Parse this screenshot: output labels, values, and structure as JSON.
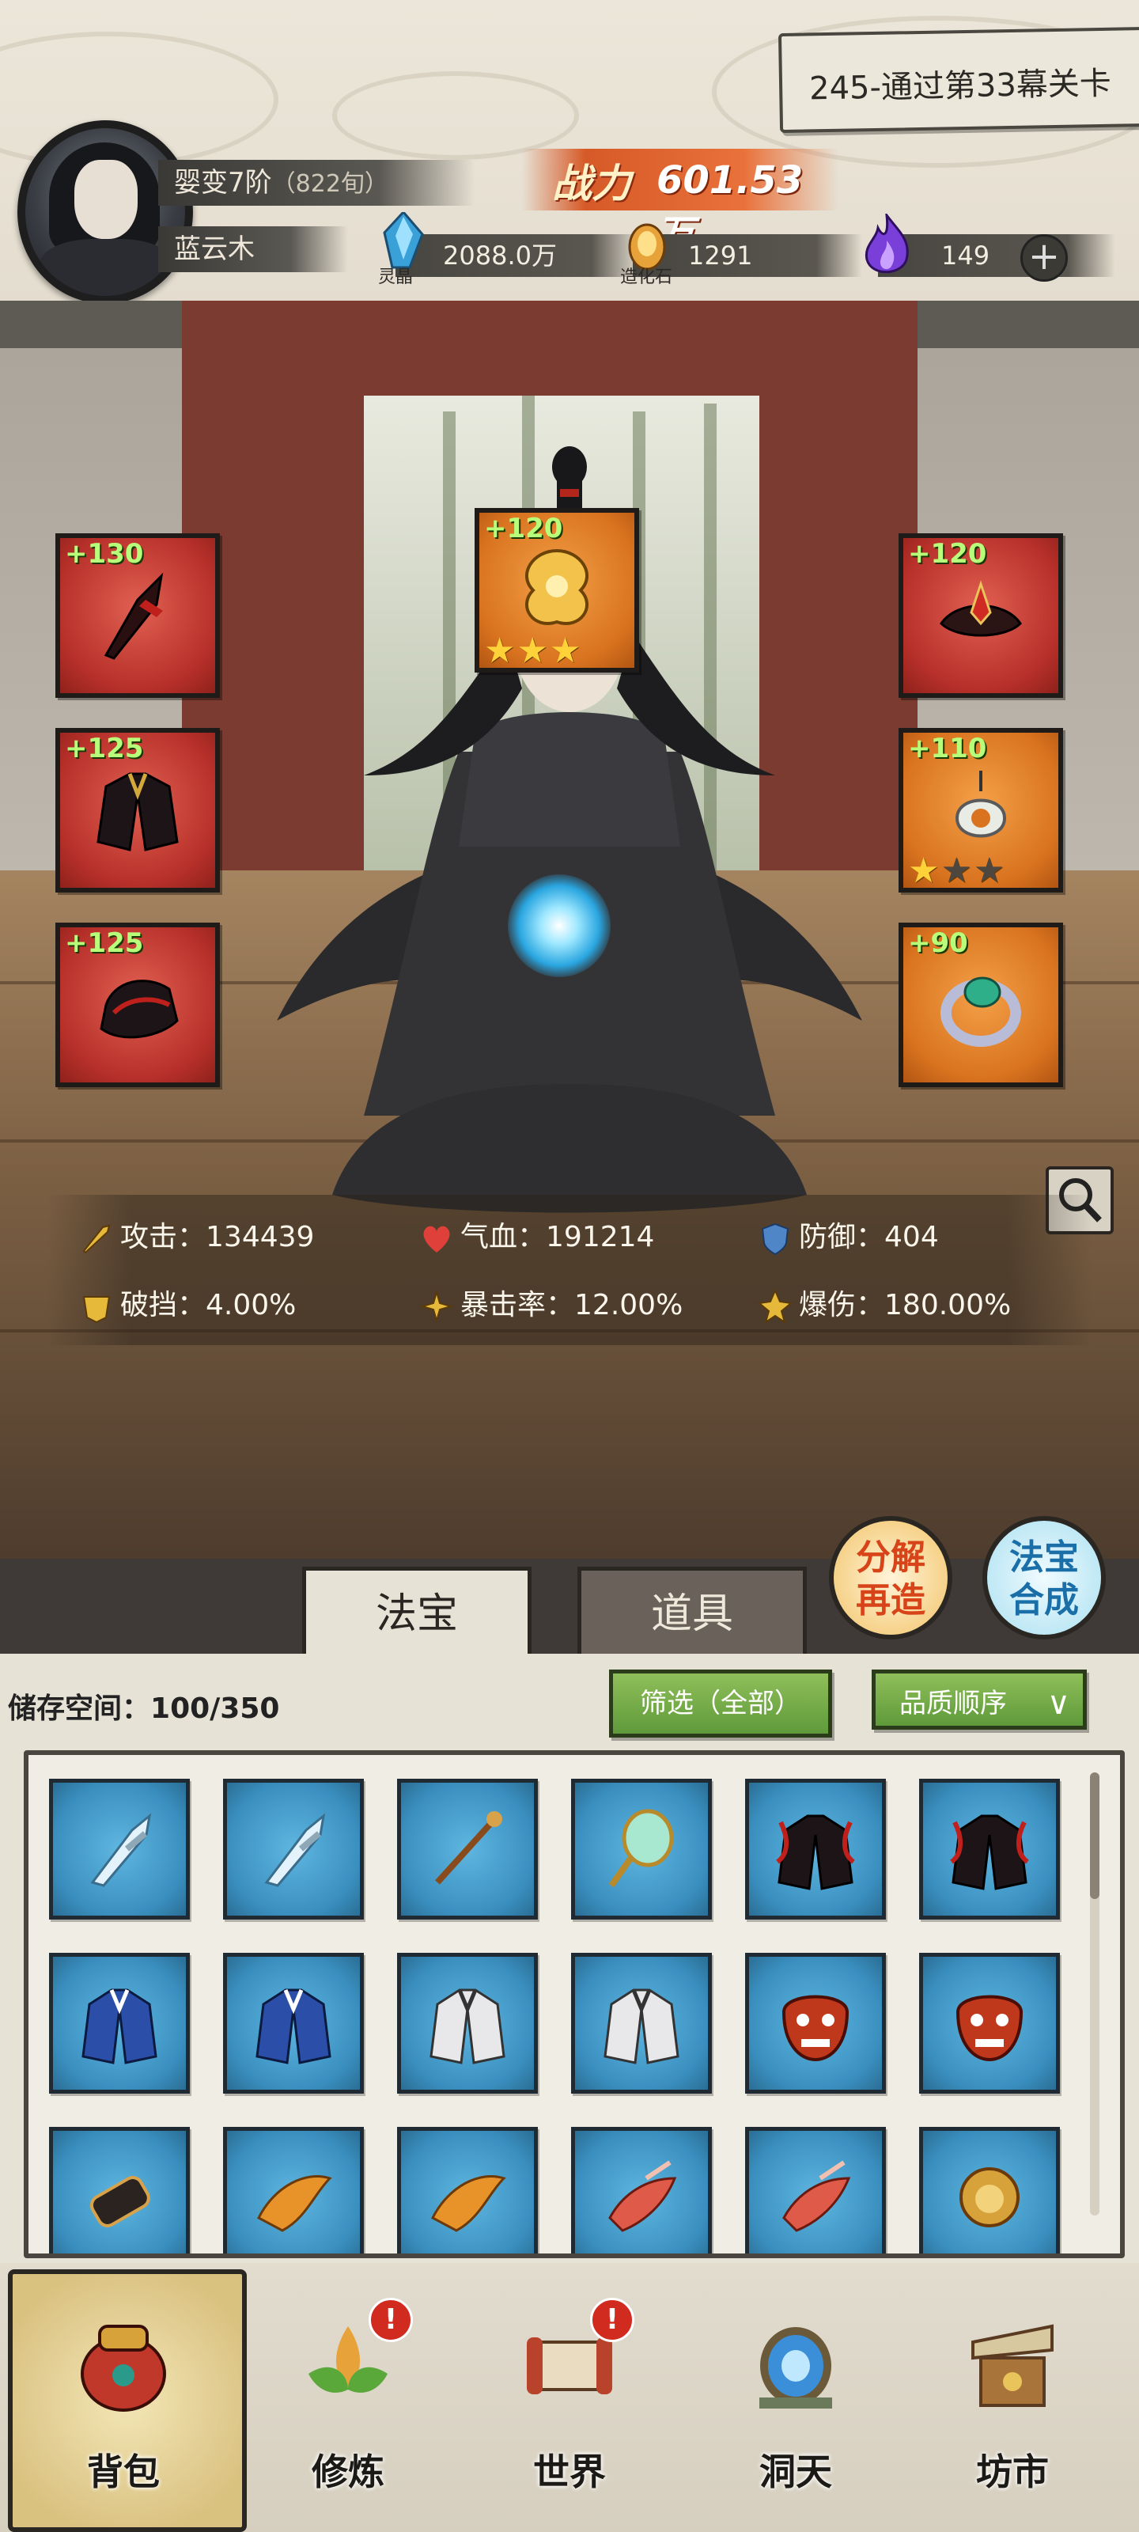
{
  "player": {
    "realm": "婴变7阶",
    "realm_detail": "（822旬）",
    "name": "蓝云木",
    "avatar_icon": "cultivator-portrait"
  },
  "combat_power": {
    "label": "战力",
    "value": "601.53万"
  },
  "resources": [
    {
      "icon": "blue-crystal-icon",
      "label": "灵晶",
      "value": "2088.0万"
    },
    {
      "icon": "creation-stone-icon",
      "label": "造化石",
      "value": "1291"
    },
    {
      "icon": "purple-flame-icon",
      "label": "",
      "value": "149"
    }
  ],
  "quest": {
    "text": "245-通过第33幕关卡"
  },
  "equipment": {
    "left": [
      {
        "level": "+130",
        "icon": "dagger-icon",
        "rarity": "red"
      },
      {
        "level": "+125",
        "icon": "robe-icon",
        "rarity": "red"
      },
      {
        "level": "+125",
        "icon": "boots-icon",
        "rarity": "red"
      }
    ],
    "center": {
      "level": "+120",
      "icon": "golden-dragon-icon",
      "rarity": "orange",
      "stars": 3,
      "max_stars": 3
    },
    "right": [
      {
        "level": "+120",
        "icon": "crown-icon",
        "rarity": "red"
      },
      {
        "level": "+110",
        "icon": "jade-pendant-icon",
        "rarity": "orange",
        "stars": 1,
        "max_stars": 3
      },
      {
        "level": "+90",
        "icon": "emerald-ring-icon",
        "rarity": "orange"
      }
    ]
  },
  "stats": [
    {
      "icon": "sword-icon",
      "label": "攻击：",
      "value": "134439"
    },
    {
      "icon": "heart-icon",
      "label": "气血：",
      "value": "191214"
    },
    {
      "icon": "shield-icon",
      "label": "防御：",
      "value": "404"
    },
    {
      "icon": "break-block-icon",
      "label": "破挡：",
      "value": "4.00%"
    },
    {
      "icon": "crit-rate-icon",
      "label": "暴击率：",
      "value": "12.00%"
    },
    {
      "icon": "crit-damage-icon",
      "label": "爆伤：",
      "value": "180.00%"
    }
  ],
  "tabs": {
    "treasure": "法宝",
    "items": "道具",
    "active": "treasure"
  },
  "action_buttons": {
    "decompose_line1": "分解",
    "decompose_line2": "再造",
    "synth_line1": "法宝",
    "synth_line2": "合成"
  },
  "inventory": {
    "storage_label": "储存空间：",
    "storage_value": "100/350",
    "filter_label": "筛选（全部）",
    "sort_label": "品质顺序",
    "items": [
      "ice-sword-icon",
      "ice-sword-icon",
      "bronze-staff-icon",
      "jade-mirror-icon",
      "red-dark-robe-icon",
      "red-dark-robe-icon",
      "blue-robe-icon",
      "blue-robe-icon",
      "white-robe-icon",
      "white-robe-icon",
      "demon-mask-icon",
      "demon-mask-icon",
      "gauntlet-icon",
      "phoenix-boot-icon",
      "phoenix-boot-icon",
      "feather-boot-icon",
      "feather-boot-icon",
      "golden-lion-icon"
    ]
  },
  "nav": [
    {
      "label": "背包",
      "icon": "backpack-icon",
      "badge": "",
      "active": true
    },
    {
      "label": "修炼",
      "icon": "lotus-icon",
      "badge": "!",
      "active": false
    },
    {
      "label": "世界",
      "icon": "scroll-map-icon",
      "badge": "!",
      "active": false
    },
    {
      "label": "洞天",
      "icon": "portal-icon",
      "badge": "",
      "active": false
    },
    {
      "label": "坊市",
      "icon": "market-stall-icon",
      "badge": "",
      "active": false
    }
  ],
  "colors": {
    "rarity_red": "#b8302a",
    "rarity_orange": "#d9731f",
    "item_blue": "#3a8fbf",
    "power_orange": "#e9713a"
  }
}
